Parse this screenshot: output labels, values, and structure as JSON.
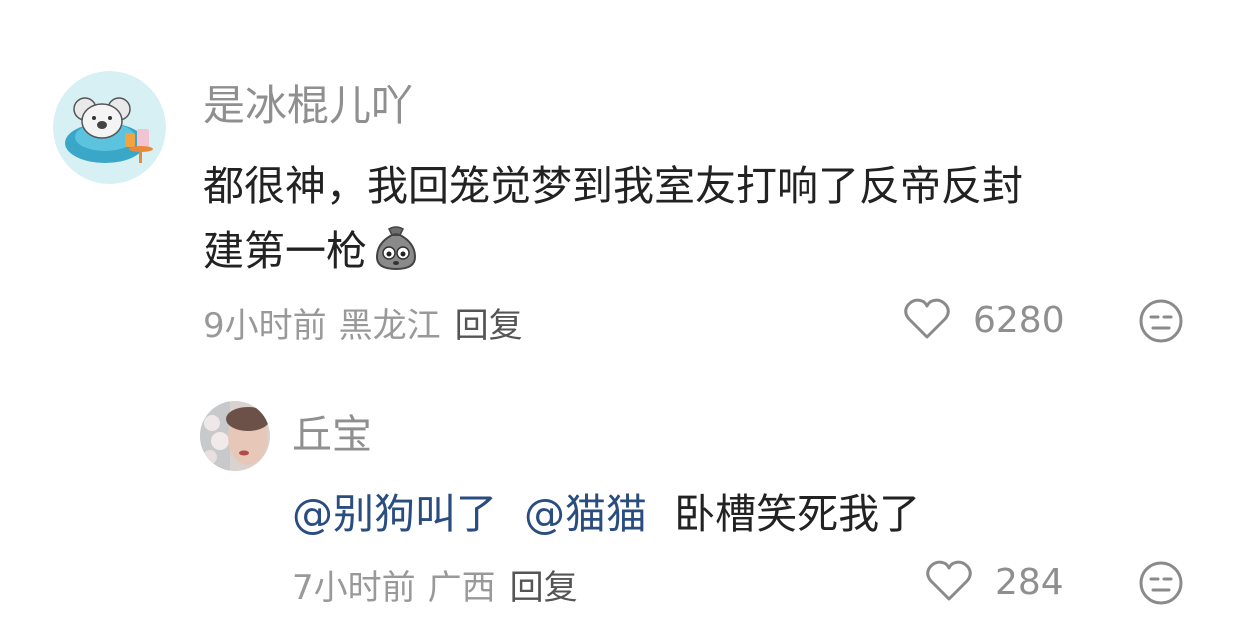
{
  "comments": [
    {
      "username": "是冰棍儿吖",
      "text_line1": "都很神，我回笼觉梦到我室友打响了反帝反封",
      "text_line2": "建第一枪",
      "inline_emoji": "bag-emoji",
      "time": "9小时前",
      "location": "黑龙江",
      "reply_label": "回复",
      "likes": "6280",
      "avatar": "koala-avatar"
    },
    {
      "username": "丘宝",
      "mention1": "@别狗叫了",
      "mention2": "@猫猫",
      "text": "卧槽笑死我了",
      "time": "7小时前",
      "location": "广西",
      "reply_label": "回复",
      "likes": "284",
      "avatar": "photo-avatar"
    }
  ],
  "icons": {
    "like": "heart-outline-icon",
    "reaction": "meh-face-icon"
  },
  "colors": {
    "username": "#8f8f8f",
    "text": "#222222",
    "meta": "#999999",
    "mention": "#2a4d80"
  }
}
